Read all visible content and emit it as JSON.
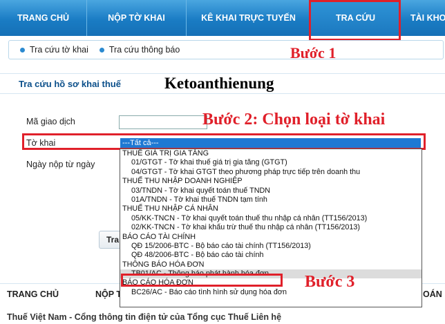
{
  "topnav": {
    "tabs": [
      {
        "label": "TRANG CHỦ"
      },
      {
        "label": "NỘP TỜ KHAI"
      },
      {
        "label": "KÊ KHAI TRỰC TUYẾN"
      },
      {
        "label": "TRA CỨU"
      },
      {
        "label": "TÀI KHO"
      }
    ]
  },
  "subnav": {
    "items": [
      {
        "label": "Tra cứu tờ khai"
      },
      {
        "label": "Tra cứu thông báo"
      }
    ]
  },
  "annotations": {
    "step1": "Bước 1",
    "step2": "Bước 2: Chọn loại tờ khai",
    "step3": "Bước 3",
    "colors": {
      "annotation": "#e0202a",
      "nav": "#1a7cc4",
      "selection": "#1e79d3"
    }
  },
  "page": {
    "section_title": "Tra cứu hồ sơ khai thuế",
    "watermark": "Ketoanthienung"
  },
  "form": {
    "transaction_label": "Mã giao dịch",
    "transaction_value": "",
    "declaration_label": "Tờ khai",
    "selected_option": "---Tất cả---",
    "submit_date_label": "Ngày nộp từ ngày",
    "search_button_partial": "Tra"
  },
  "dropdown": {
    "rows": [
      {
        "kind": "group",
        "text": "THUẾ GIÁ TRỊ GIA TĂNG"
      },
      {
        "kind": "option",
        "text": "01/GTGT - Tờ khai thuế giá trị gia tăng (GTGT)"
      },
      {
        "kind": "option",
        "text": "04/GTGT - Tờ khai GTGT theo phương pháp trực tiếp trên doanh thu"
      },
      {
        "kind": "group",
        "text": "THUẾ THU NHẬP DOANH NGHIỆP"
      },
      {
        "kind": "option",
        "text": "03/TNDN - Tờ khai quyết toán thuế TNDN"
      },
      {
        "kind": "option",
        "text": "01A/TNDN - Tờ khai thuế TNDN tạm tính"
      },
      {
        "kind": "group",
        "text": "THUẾ THU NHẬP CÁ NHÂN"
      },
      {
        "kind": "option",
        "text": "05/KK-TNCN - Tờ khai quyết toán thuế thu nhập cá nhân (TT156/2013)"
      },
      {
        "kind": "option",
        "text": "02/KK-TNCN - Tờ khai khấu trừ thuế thu nhập cá nhân (TT156/2013)"
      },
      {
        "kind": "group",
        "text": "BÁO CÁO TÀI CHÍNH"
      },
      {
        "kind": "option",
        "text": "QĐ 15/2006-BTC - Bộ báo cáo tài chính (TT156/2013)"
      },
      {
        "kind": "option",
        "text": "QĐ 48/2006-BTC - Bộ báo cáo tài chính"
      },
      {
        "kind": "group",
        "text": "THÔNG BÁO HÓA ĐƠN"
      },
      {
        "kind": "option",
        "text": "TB01/AC - Thông báo phát hành hóa đơn",
        "highlight": true
      },
      {
        "kind": "group",
        "text": "BÁO CÁO HÓA ĐƠN"
      },
      {
        "kind": "option",
        "text": "BC26/AC - Báo cáo tình hình sử dụng hóa đơn"
      }
    ]
  },
  "footer": {
    "nav1": "TRANG CHỦ",
    "nav2": "NỘP T",
    "nav3": "OÁN",
    "copyright": "Thuế Việt Nam - Cổng thông tin điện tử của Tổng cục Thuế Liên hệ"
  }
}
